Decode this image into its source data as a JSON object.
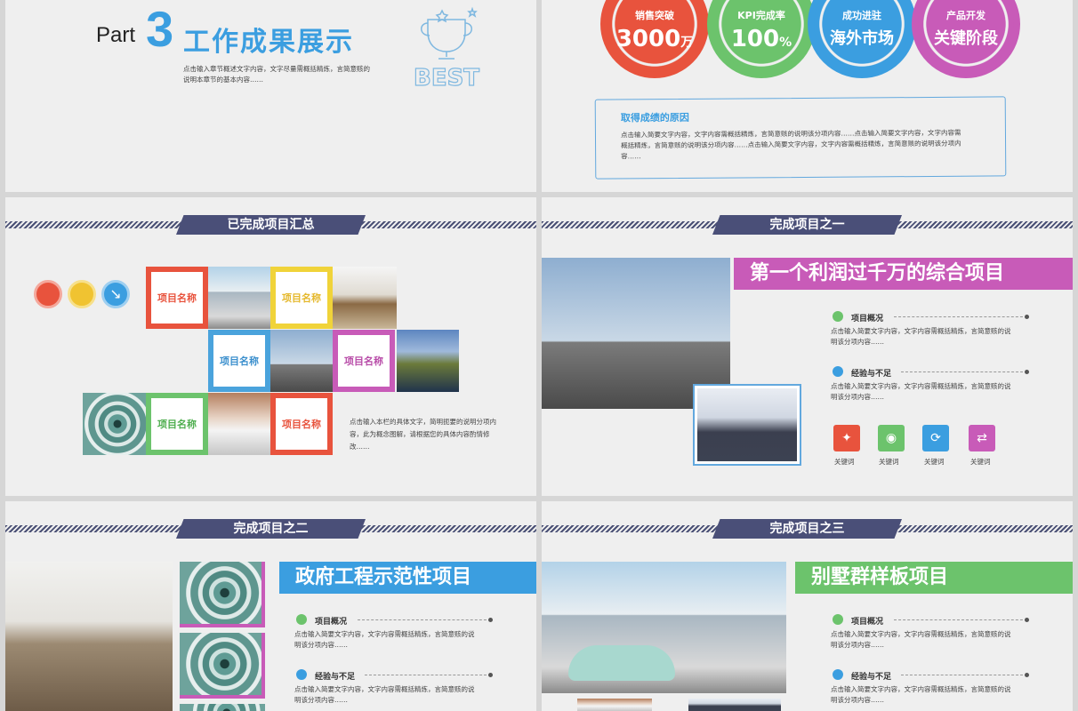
{
  "slide1": {
    "part_label": "Part",
    "part_number": "3",
    "title": "工作成果展示",
    "desc_line1": "点击输入章节概述文字内容，文字尽量需概括精炼，言简意赅的",
    "desc_line2": "说明本章节的基本内容……",
    "trophy_text": "BEST"
  },
  "slide2": {
    "circles": [
      {
        "top": "销售突破",
        "value": "3000",
        "unit": "万",
        "color": "#e8533d"
      },
      {
        "top": "KPI完成率",
        "value": "100",
        "unit": "%",
        "color": "#6cc36c"
      },
      {
        "top": "成功进驻",
        "value": "海外市场",
        "unit": "",
        "color": "#3b9ee0"
      },
      {
        "top": "产品开发",
        "value": "关键阶段",
        "unit": "",
        "color": "#c85bb8"
      }
    ],
    "reason_title": "取得成绩的原因",
    "reason_line1": "点击输入简要文字内容，文字内容需概括精炼，言简意赅的说明该分项内容……点击输入简要文字内容，文字内容需",
    "reason_line2": "概括精炼，言简意赅的说明该分项内容……点击输入简要文字内容，文字内容需概括精炼，言简意赅的说明该分项内",
    "reason_line3": "容……"
  },
  "slide3": {
    "banner": "已完成项目汇总",
    "box_label": "项目名称",
    "desc_line1": "点击输入本栏的具体文字，简明扼要的说明分项内",
    "desc_line2": "容，此为概念图解，请根据您的具体内容酌情修",
    "desc_line3": "改……"
  },
  "slide4": {
    "banner": "完成项目之一",
    "headline": "第一个利润过千万的综合项目",
    "headline_color": "#c85bb8",
    "sec1_title": "项目概况",
    "sec1_line1": "点击输入简要文字内容，文字内容需概括精炼，言简意赅的说",
    "sec1_line2": "明该分项内容……",
    "sec2_title": "经验与不足",
    "sec2_line1": "点击输入简要文字内容，文字内容需概括精炼，言简意赅的说",
    "sec2_line2": "明该分项内容……",
    "keyword": "关键词"
  },
  "slide5": {
    "banner": "完成项目之二",
    "headline": "政府工程示范性项目",
    "headline_color": "#3b9ee0",
    "sec1_title": "项目概况",
    "sec1_line1": "点击输入简要文字内容，文字内容需概括精炼，言简意赅的说",
    "sec1_line2": "明该分项内容……",
    "sec2_title": "经验与不足",
    "sec2_line1": "点击输入简要文字内容，文字内容需概括精炼，言简意赅的说",
    "sec2_line2": "明该分项内容……"
  },
  "slide6": {
    "banner": "完成项目之三",
    "headline": "别墅群样板项目",
    "headline_color": "#6cc36c",
    "sec1_title": "项目概况",
    "sec1_line1": "点击输入简要文字内容，文字内容需概括精炼，言简意赅的说",
    "sec1_line2": "明该分项内容……",
    "sec2_title": "经验与不足",
    "sec2_line1": "点击输入简要文字内容，文字内容需概括精炼，言简意赅的说",
    "sec2_line2": "明该分项内容……"
  }
}
